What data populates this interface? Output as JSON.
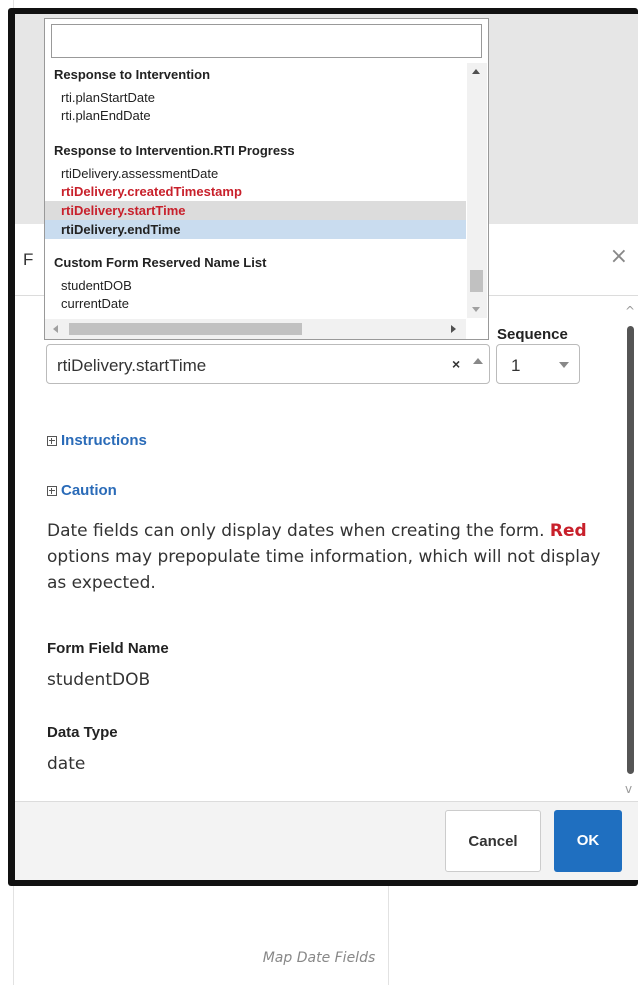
{
  "dialog": {
    "title_fragment": "F",
    "close_glyph": "×",
    "sequence_label": "Sequence",
    "selected_field": "rtiDelivery.startTime",
    "clear_glyph": "×",
    "sequence_value": "1",
    "instructions_label": "Instructions",
    "caution_label": "Caution",
    "caution_text_part1": "Date fields can only display dates when creating the form. ",
    "caution_text_red": "Red",
    "caution_text_part2": " options may prepopulate time information, which will not display as expected.",
    "form_field_name_label": "Form Field Name",
    "form_field_name_value": "studentDOB",
    "data_type_label": "Data Type",
    "data_type_value": "date",
    "cancel_label": "Cancel",
    "ok_label": "OK"
  },
  "dropdown": {
    "search_value": "",
    "groups": [
      {
        "label": "Response to Intervention",
        "items": [
          {
            "label": "rti.planStartDate",
            "style": "normal"
          },
          {
            "label": "rti.planEndDate",
            "style": "normal"
          }
        ]
      },
      {
        "label": "Response to Intervention.RTI Progress",
        "items": [
          {
            "label": "rtiDelivery.assessmentDate",
            "style": "normal"
          },
          {
            "label": "rtiDelivery.createdTimestamp",
            "style": "red"
          },
          {
            "label": "rtiDelivery.startTime",
            "style": "red-selected"
          },
          {
            "label": "rtiDelivery.endTime",
            "style": "highlighted"
          }
        ]
      },
      {
        "label": "Custom Form Reserved Name List",
        "items": [
          {
            "label": "studentDOB",
            "style": "normal"
          },
          {
            "label": "currentDate",
            "style": "normal"
          }
        ]
      }
    ]
  },
  "caption": "Map Date Fields",
  "colors": {
    "accent": "#1f6fc0",
    "link": "#2a6bb8",
    "warning_red": "#c8202b",
    "highlight_blue": "#c9dcef"
  }
}
